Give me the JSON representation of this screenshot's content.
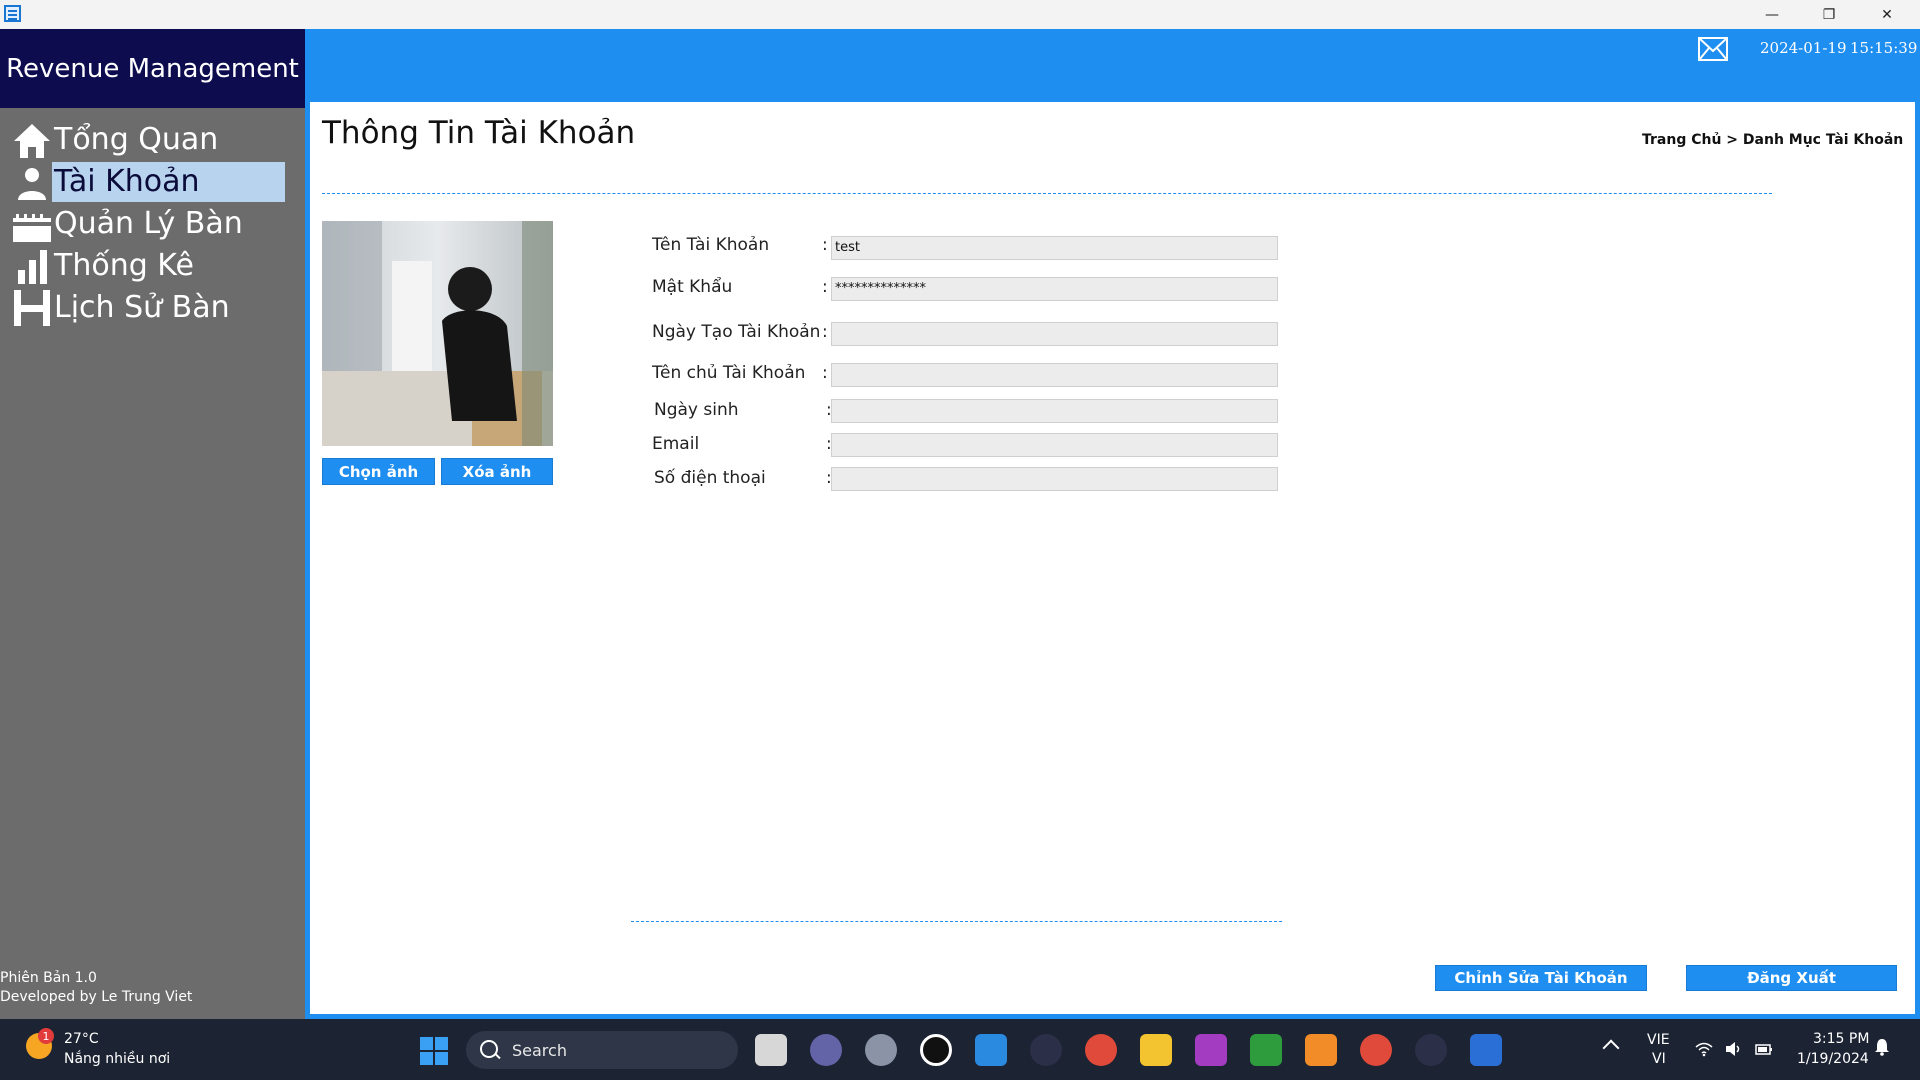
{
  "window": {
    "minimize_label": "—",
    "maximize_label": "❐",
    "close_label": "✕"
  },
  "sidebar": {
    "title": "Revenue Management",
    "items": [
      {
        "label": "Tổng Quan",
        "icon": "home-icon",
        "selected": false
      },
      {
        "label": "Tài Khoản",
        "icon": "user-icon",
        "selected": true
      },
      {
        "label": "Quản Lý Bàn",
        "icon": "table-icon",
        "selected": false
      },
      {
        "label": "Thống Kê",
        "icon": "bar-chart-icon",
        "selected": false
      },
      {
        "label": "Lịch Sử Bàn",
        "icon": "history-table-icon",
        "selected": false
      }
    ],
    "version": "Phiên Bản 1.0",
    "developer": "Developed by Le Trung Viet"
  },
  "header": {
    "date": "2024-01-19",
    "time": "15:15:39",
    "mail_icon": "mail-icon"
  },
  "page": {
    "title": "Thông Tin Tài Khoản",
    "breadcrumb": "Trang Chủ > Danh Mục Tài Khoản"
  },
  "photo": {
    "choose_label": "Chọn ảnh",
    "delete_label": "Xóa ảnh"
  },
  "form": {
    "fields": [
      {
        "label": "Tên Tài Khoản",
        "value": "test"
      },
      {
        "label": "Mật Khẩu",
        "value": "**************"
      },
      {
        "label": "Ngày Tạo Tài Khoản",
        "value": ""
      },
      {
        "label": "Tên chủ Tài Khoản",
        "value": ""
      },
      {
        "label": "Ngày sinh",
        "value": ""
      },
      {
        "label": "Email",
        "value": ""
      },
      {
        "label": "Số điện thoại",
        "value": ""
      }
    ],
    "colon": ":"
  },
  "actions": {
    "edit_label": "Chỉnh Sửa Tài Khoản",
    "logout_label": "Đăng Xuất"
  },
  "colors": {
    "accent": "#1f8ef1",
    "sidebar_bg": "#6c6c6c",
    "sidebar_header_bg": "#0c0c4f",
    "selected_bg": "#b7d3ee",
    "taskbar_bg": "#1c2333"
  },
  "taskbar": {
    "weather": {
      "temp": "27°C",
      "desc": "Nắng nhiều nơi",
      "badge": "1"
    },
    "search_label": "Search",
    "language_line1": "VIE",
    "language_line2": "VI",
    "time": "3:15 PM",
    "date": "1/19/2024"
  }
}
